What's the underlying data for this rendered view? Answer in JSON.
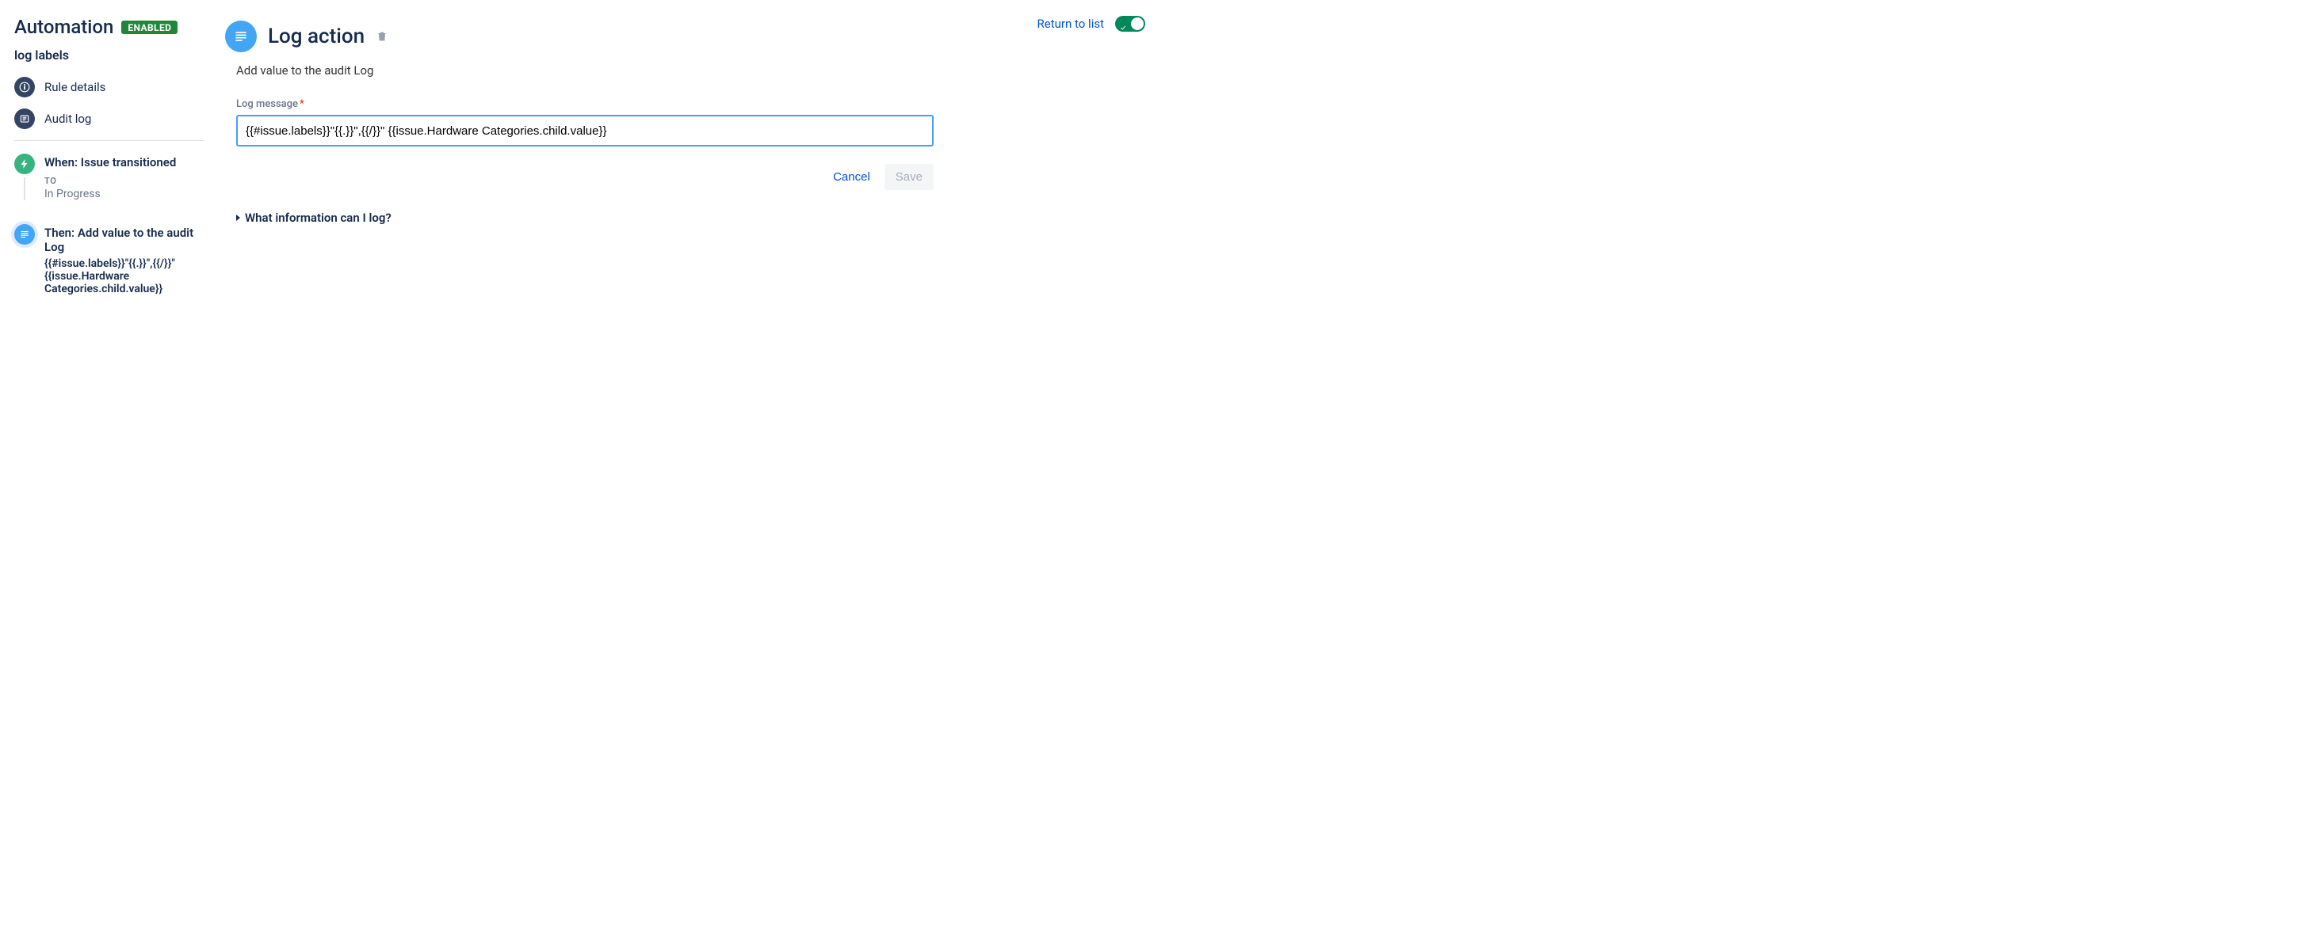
{
  "header": {
    "title": "Automation",
    "badge": "ENABLED",
    "return_link": "Return to list",
    "toggle_on": true
  },
  "rule": {
    "name": "log labels",
    "nav": {
      "details": "Rule details",
      "audit": "Audit log"
    },
    "steps": [
      {
        "kind": "trigger",
        "title": "When: Issue transitioned",
        "meta_label": "TO",
        "meta_value": "In Progress"
      },
      {
        "kind": "action",
        "title": "Then: Add value to the audit Log",
        "body": "{{#issue.labels}}\"{{.}}\",{{/}}\" {{issue.Hardware Categories.child.value}}"
      }
    ]
  },
  "panel": {
    "title": "Log action",
    "subtitle": "Add value to the audit Log",
    "field_label": "Log message",
    "field_value": "{{#issue.labels}}\"{{.}}\",{{/}}\" {{issue.Hardware Categories.child.value}}",
    "cancel": "Cancel",
    "save": "Save",
    "disclosure": "What information can I log?"
  }
}
